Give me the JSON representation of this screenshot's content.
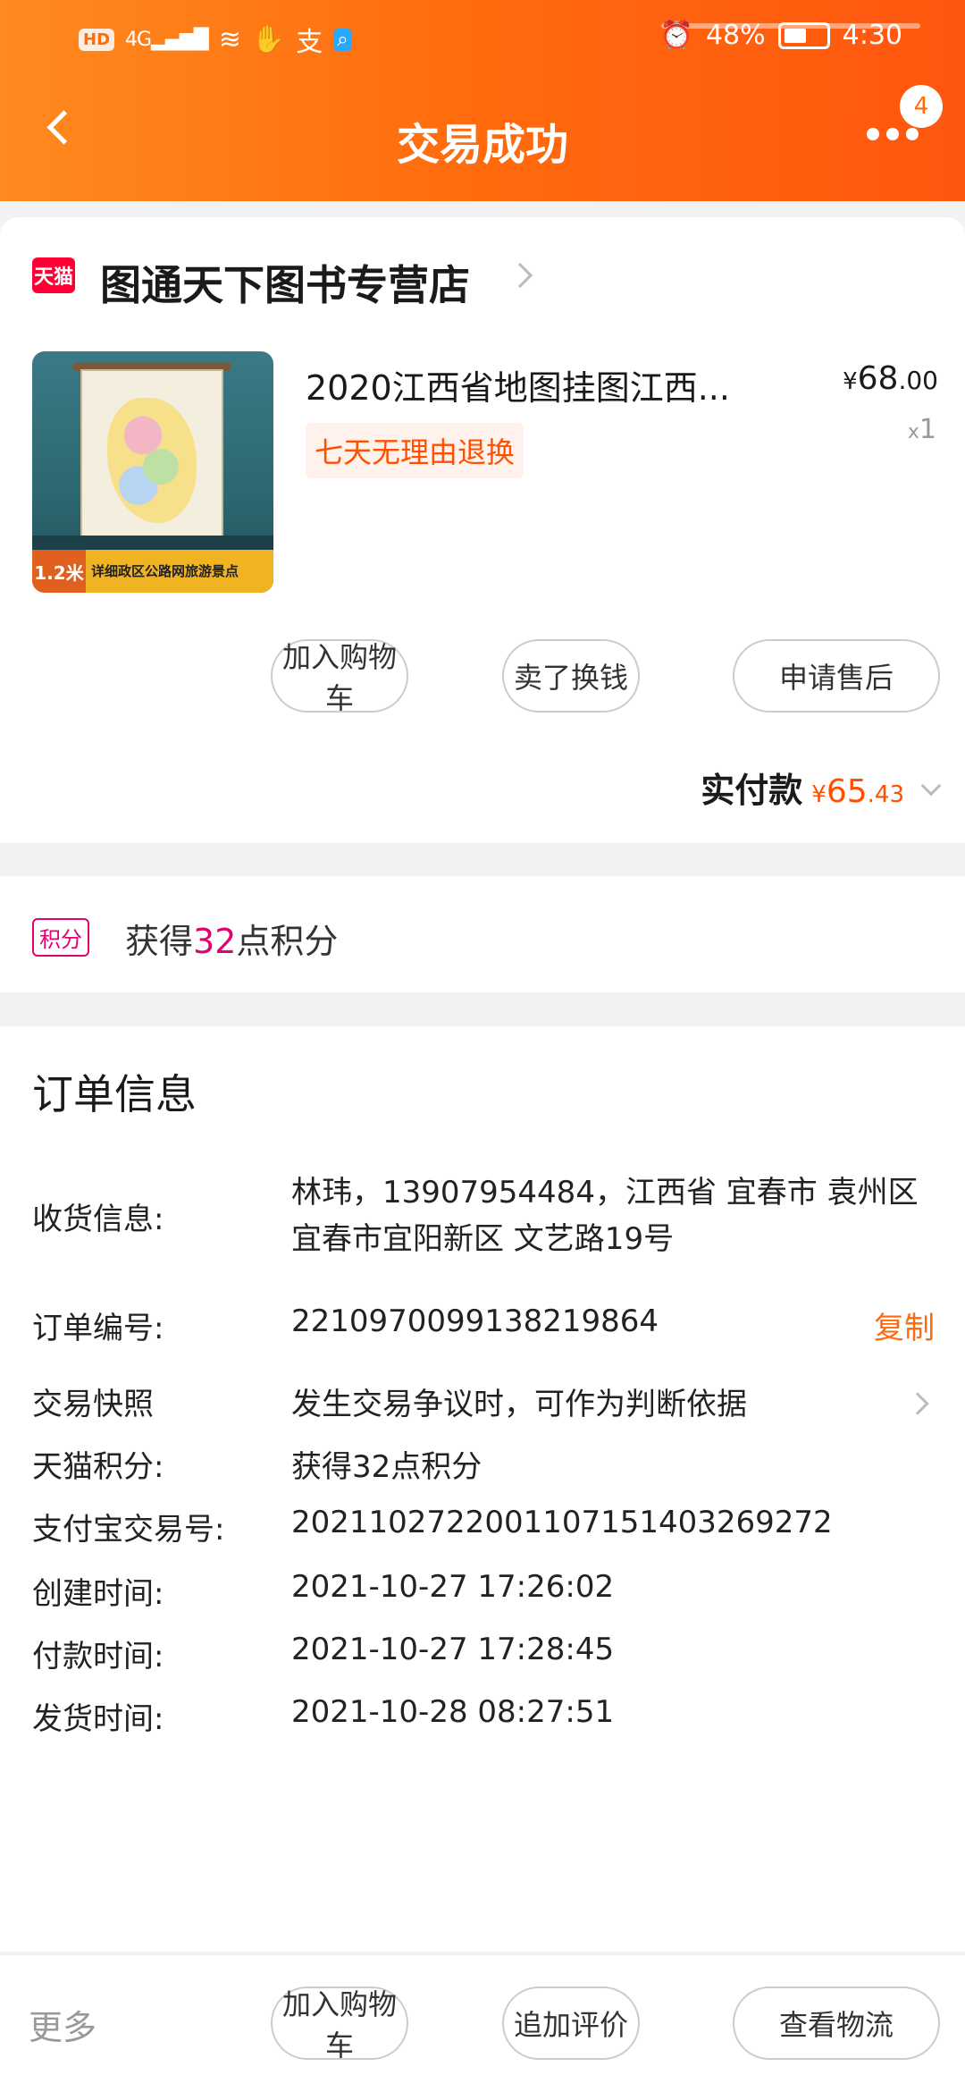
{
  "status_bar": {
    "left_pill": "HD",
    "signal": "4G",
    "alipay": "支",
    "battery": "48%",
    "time": "4:30"
  },
  "header": {
    "title": "交易成功",
    "badge_count": "4"
  },
  "shop": {
    "logo_text": "天猫",
    "name": "图通天下图书专营店"
  },
  "product": {
    "image_caption_size": "1.2米",
    "image_caption_text": "详细政区公路网旅游景点",
    "title": "2020江西省地图挂图江西...",
    "price_currency": "¥",
    "price_int": "68",
    "price_dec": ".00",
    "qty_prefix": "x",
    "qty": "1",
    "tag": "七天无理由退换"
  },
  "actions": {
    "add_cart": "加入购物车",
    "resell": "卖了换钱",
    "after_sale": "申请售后"
  },
  "payment": {
    "label": "实付款",
    "currency": "¥",
    "int": "65",
    "dec": ".43"
  },
  "points": {
    "tag": "积分",
    "prefix": "获得",
    "value": "32",
    "suffix": "点积分"
  },
  "order": {
    "heading": "订单信息",
    "rows": [
      {
        "label": "收货信息:",
        "value": "林玮，13907954484，江西省 宜春市 袁州区 宜春市宜阳新区  文艺路19号"
      },
      {
        "label": "订单编号:",
        "value": "2210970099138219864",
        "action": "复制"
      },
      {
        "label": "交易快照",
        "value": "发生交易争议时，可作为判断依据"
      },
      {
        "label": "天猫积分:",
        "value": "获得32点积分"
      },
      {
        "label": "支付宝交易号:",
        "value": "2021102722001107151403269272"
      },
      {
        "label": "创建时间:",
        "value": "2021-10-27 17:26:02"
      },
      {
        "label": "付款时间:",
        "value": "2021-10-27 17:28:45"
      },
      {
        "label": "发货时间:",
        "value": "2021-10-28 08:27:51"
      }
    ]
  },
  "bottom": {
    "more": "更多",
    "add_cart": "加入购物车",
    "add_review": "追加评价",
    "logistics": "查看物流"
  },
  "colors": {
    "brand_orange": "#ff6a0d",
    "price_orange": "#ff5000",
    "points_pink": "#e4006e",
    "tmall_red": "#ff0036"
  }
}
